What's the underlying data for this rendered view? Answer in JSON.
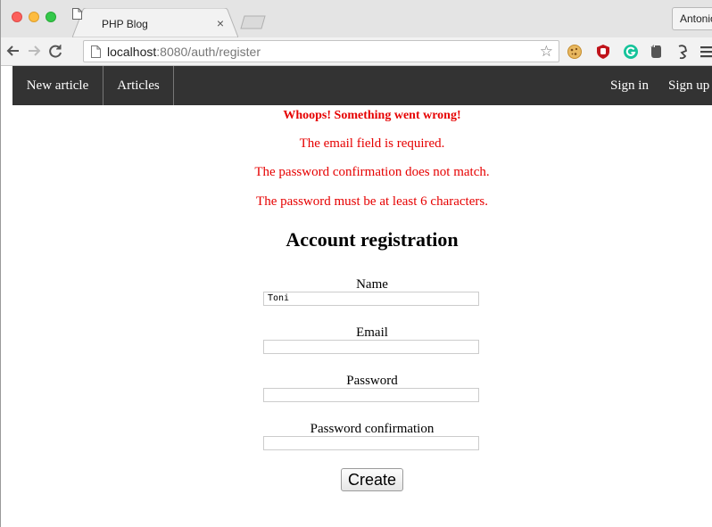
{
  "browser": {
    "tab_title": "PHP Blog",
    "tab_close": "×",
    "profile_name": "Antonio",
    "url_host": "localhost",
    "url_path": ":8080/auth/register"
  },
  "site_nav": {
    "left": [
      "New article",
      "Articles"
    ],
    "right": [
      "Sign in",
      "Sign up"
    ]
  },
  "errors": {
    "heading": "Whoops! Something went wrong!",
    "messages": [
      "The email field is required.",
      "The password confirmation does not match.",
      "The password must be at least 6 characters."
    ]
  },
  "form": {
    "title": "Account registration",
    "fields": [
      {
        "label": "Name",
        "value": "Toni"
      },
      {
        "label": "Email",
        "value": ""
      },
      {
        "label": "Password",
        "value": ""
      },
      {
        "label": "Password confirmation",
        "value": ""
      }
    ],
    "submit_label": "Create"
  },
  "colors": {
    "error": "#e60000",
    "nav_bg": "#333333"
  },
  "icons": [
    "back-arrow-icon",
    "forward-arrow-icon",
    "reload-icon",
    "page-icon",
    "star-icon",
    "cookie-icon",
    "ublock-icon",
    "grammarly-icon",
    "evernote-icon",
    "extension-icon",
    "menu-icon"
  ]
}
